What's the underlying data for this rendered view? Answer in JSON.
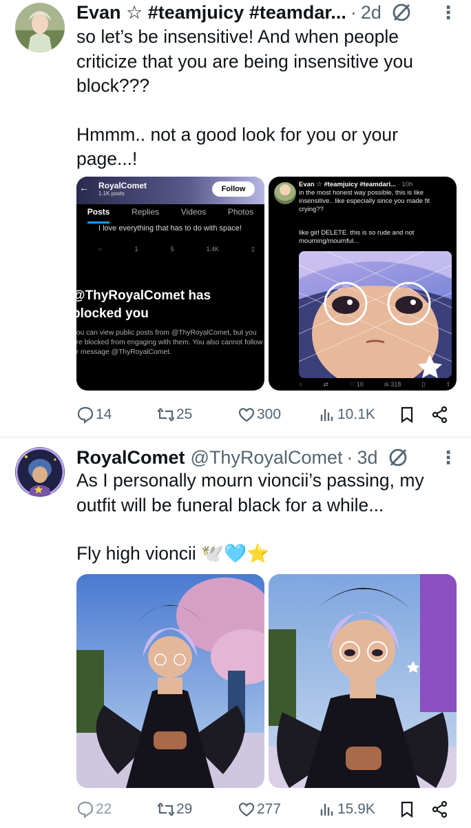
{
  "tweets": [
    {
      "author": {
        "name": "Evan ☆ #teamjuicy #teamdar...",
        "time": "2d"
      },
      "text_lines": [
        "so let’s be insensitive! And when people criticize that you are being insensitive you block???",
        "Hmmm.. not a good look for you or your page...!"
      ],
      "media": [
        {
          "kind": "blocked-profile-screenshot",
          "profile_name": "RoyalComet",
          "post_count": "1.1K posts",
          "follow_label": "Follow",
          "tabs": [
            "Posts",
            "Replies",
            "Videos",
            "Photos"
          ],
          "snippet": "I love everything that has to do with space!",
          "snippet_stats": [
            "1",
            "5",
            "1.4K"
          ],
          "blocked_title_line1": "@ThyRoyalComet has",
          "blocked_title_line2": "blocked you",
          "blocked_desc": "You can view public posts from @ThyRoyalComet, but you are blocked from engaging with them. You also cannot follow or message @ThyRoyalComet."
        },
        {
          "kind": "reply-screenshot",
          "name": "Evan ☆ #teamjuicy #teamdarl...",
          "time": "· 10h",
          "text1": "in the most honest way possible, this is like insensitive.. like especially since you made fit crying??",
          "text2": "like girl DELETE. this is so rude and not mourning/mournful...",
          "stats": [
            "10",
            "318"
          ]
        }
      ],
      "actions": {
        "replies": "14",
        "reposts": "25",
        "likes": "300",
        "views": "10.1K"
      }
    },
    {
      "author": {
        "name": "RoyalComet",
        "handle": "@ThyRoyalComet",
        "time": "3d"
      },
      "text_lines": [
        "As I personally mourn vioncii’s passing, my outfit will be funeral black for a while...",
        "Fly high vioncii 🕊️🩵⭐"
      ],
      "actions": {
        "replies": "22",
        "reposts": "29",
        "likes": "277",
        "views": "15.9K"
      }
    }
  ],
  "colors": {
    "text": "#0f1419",
    "secondary": "#536471",
    "divider": "#e6e9ea",
    "accent": "#1d9bf0"
  },
  "icons": [
    "more-icon",
    "muted-grok-icon",
    "reply-icon",
    "repost-icon",
    "like-icon",
    "views-icon",
    "bookmark-icon",
    "share-icon"
  ]
}
